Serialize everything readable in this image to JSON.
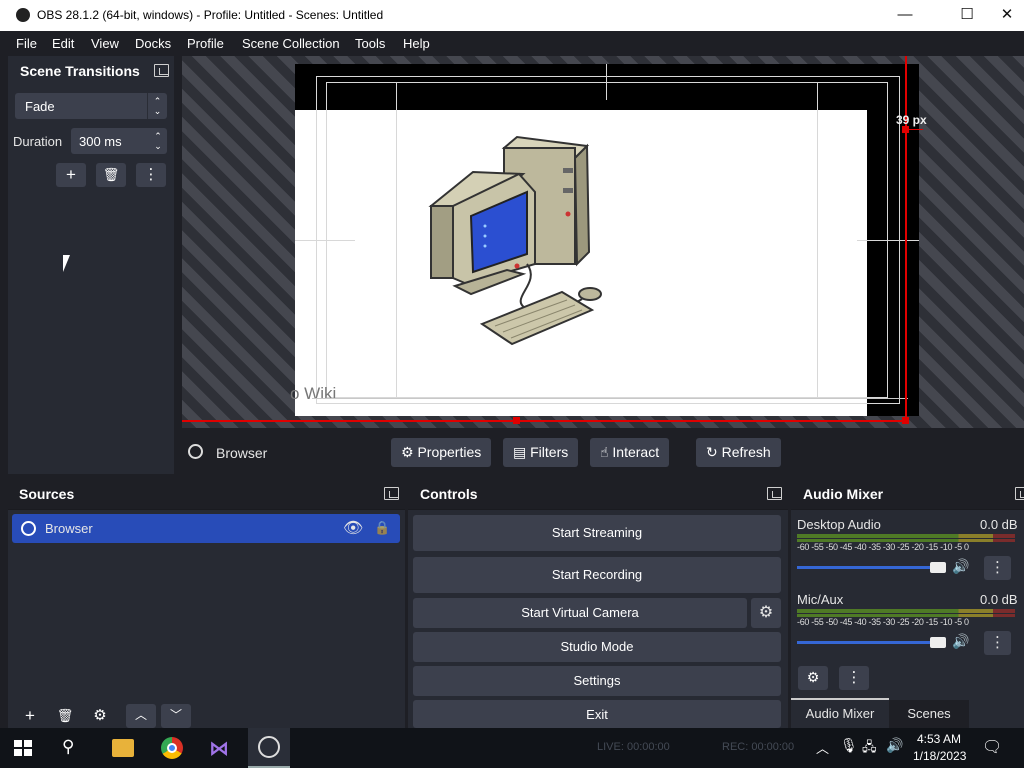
{
  "window": {
    "title": "OBS 28.1.2 (64-bit, windows) - Profile: Untitled - Scenes: Untitled",
    "minimize": "—",
    "maximize": "☐",
    "close": "✕"
  },
  "menu": [
    "File",
    "Edit",
    "View",
    "Docks",
    "Profile",
    "Scene Collection",
    "Tools",
    "Help"
  ],
  "scene_transitions": {
    "title": "Scene Transitions",
    "transition": "Fade",
    "duration_label": "Duration",
    "duration_value": "300 ms"
  },
  "preview": {
    "page_text": "o Wiki",
    "measure_label": "39 px"
  },
  "source_toolbar": {
    "source_name": "Browser",
    "properties": "Properties",
    "filters": "Filters",
    "interact": "Interact",
    "refresh": "Refresh"
  },
  "sources": {
    "title": "Sources",
    "items": [
      {
        "name": "Browser"
      }
    ]
  },
  "controls": {
    "title": "Controls",
    "start_streaming": "Start Streaming",
    "start_recording": "Start Recording",
    "start_virtual_camera": "Start Virtual Camera",
    "studio_mode": "Studio Mode",
    "settings": "Settings",
    "exit": "Exit"
  },
  "audio_mixer": {
    "title": "Audio Mixer",
    "channels": [
      {
        "name": "Desktop Audio",
        "level": "0.0 dB",
        "volume": 1.0
      },
      {
        "name": "Mic/Aux",
        "level": "0.0 dB",
        "volume": 1.0
      }
    ],
    "scale": "-60 -55 -50 -45 -40 -35 -30 -25 -20 -15 -10 -5 0",
    "tabs": [
      "Audio Mixer",
      "Scenes"
    ]
  },
  "status": {
    "live": "LIVE: 00:00:00",
    "rec": "REC: 00:00:00"
  },
  "taskbar": {
    "time": "4:53 AM",
    "date": "1/18/2023"
  },
  "colors": {
    "accent": "#284cb8",
    "panel": "#272a33",
    "background": "#1e1f25",
    "button": "#3c404d",
    "selection_red": "#e00000"
  }
}
